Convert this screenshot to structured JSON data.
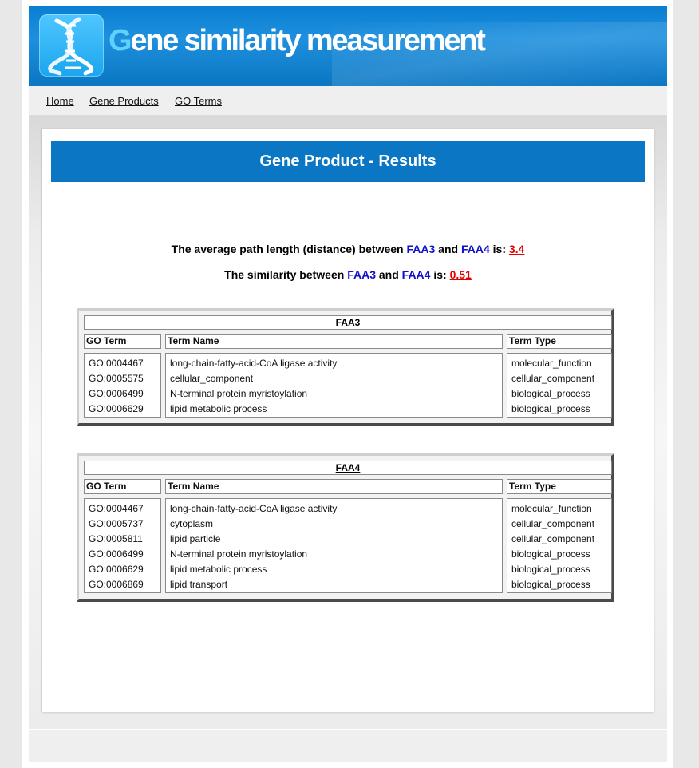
{
  "header": {
    "title_first": "G",
    "title_rest": "ene similarity measurement",
    "logo_icon": "dna-helix-icon"
  },
  "nav": {
    "items": [
      {
        "label": "Home"
      },
      {
        "label": "Gene Products"
      },
      {
        "label": "GO Terms"
      }
    ]
  },
  "results": {
    "heading": "Gene Product - Results",
    "line1": {
      "prefix": "The average path length (distance) between ",
      "gene_a": "FAA3",
      "and": " and ",
      "gene_b": "FAA4",
      "is": " is: ",
      "value": "3.4"
    },
    "line2": {
      "prefix": "The similarity between ",
      "gene_a": "FAA3",
      "and": " and ",
      "gene_b": "FAA4",
      "is": " is: ",
      "value": "0.51"
    }
  },
  "tables": {
    "columns": {
      "go_term": "GO Term",
      "term_name": "Term Name",
      "term_type": "Term Type"
    },
    "faa3": {
      "title": "FAA3",
      "go_terms": [
        "GO:0004467",
        "GO:0005575",
        "GO:0006499",
        "GO:0006629"
      ],
      "term_names": [
        "long-chain-fatty-acid-CoA ligase activity",
        "cellular_component",
        "N-terminal protein myristoylation",
        "lipid metabolic process"
      ],
      "term_types": [
        "molecular_function",
        "cellular_component",
        "biological_process",
        "biological_process"
      ]
    },
    "faa4": {
      "title": "FAA4",
      "go_terms": [
        "GO:0004467",
        "GO:0005737",
        "GO:0005811",
        "GO:0006499",
        "GO:0006629",
        "GO:0006869"
      ],
      "term_names": [
        "long-chain-fatty-acid-CoA ligase activity",
        "cytoplasm",
        "lipid particle",
        "N-terminal protein myristoylation",
        "lipid metabolic process",
        "lipid transport"
      ],
      "term_types": [
        "molecular_function",
        "cellular_component",
        "cellular_component",
        "biological_process",
        "biological_process",
        "biological_process"
      ]
    }
  },
  "colors": {
    "header_blue": "#0a7ed1",
    "gene_link": "#1010c8",
    "value_red": "#e00000"
  }
}
